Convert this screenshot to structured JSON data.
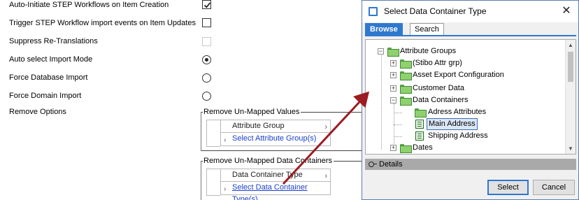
{
  "settings": {
    "rows": [
      {
        "label": "Auto-Initiate STEP Workflows on Item Creation",
        "control": "checkbox",
        "state": "checked"
      },
      {
        "label": "Trigger STEP Workflow import events on Item Updates",
        "control": "checkbox",
        "state": "unchecked"
      },
      {
        "label": "Suppress Re-Translations",
        "control": "checkbox",
        "state": "disabled"
      },
      {
        "label": "Auto select Import Mode",
        "control": "radio",
        "state": "selected"
      },
      {
        "label": "Force Database Import",
        "control": "radio",
        "state": "unselected"
      },
      {
        "label": "Force Domain Import",
        "control": "radio",
        "state": "unselected"
      },
      {
        "label": "Remove Options",
        "control": "none",
        "state": ""
      }
    ],
    "unmapped_values": {
      "title": "Remove Un-Mapped Values",
      "header": "Attribute Group",
      "link": "Select Attribute Group(s)"
    },
    "unmapped_containers": {
      "title": "Remove Un-Mapped Data Containers",
      "header": "Data Container Type",
      "link": "Select Data Container Type(s)"
    }
  },
  "dialog": {
    "title": "Select Data Container Type",
    "tabs": [
      "Browse",
      "Search"
    ],
    "active_tab": "Browse",
    "tree": [
      {
        "label": "Attribute Groups",
        "expander": "−",
        "icon": "folder-icon"
      },
      {
        "label": "(Stibo Attr grp)",
        "expander": "+",
        "icon": "folder-icon"
      },
      {
        "label": "Asset Export Configuration",
        "expander": "+",
        "icon": "folder-icon"
      },
      {
        "label": "Customer Data",
        "expander": "+",
        "icon": "folder-icon"
      },
      {
        "label": "Data Containers",
        "expander": "−",
        "icon": "folder-icon"
      },
      {
        "label": "Adress Attributes",
        "expander": "",
        "icon": "folder-icon"
      },
      {
        "label": "Main Address",
        "expander": "",
        "icon": "data-container-icon",
        "selected": true
      },
      {
        "label": "Shipping Address",
        "expander": "",
        "icon": "data-container-icon"
      },
      {
        "label": "Dates",
        "expander": "+",
        "icon": "folder-icon"
      }
    ],
    "details_label": "Details",
    "buttons": {
      "select": "Select",
      "cancel": "Cancel"
    },
    "close_glyph": "✕"
  },
  "glyphs": {
    "chevron": "›",
    "scroll_up": "▲",
    "scroll_down": "▼"
  },
  "colors": {
    "accent": "#2f78cf",
    "arrow": "#9b1c22",
    "link": "#1a3fcf",
    "folder": "#8fd06f"
  }
}
